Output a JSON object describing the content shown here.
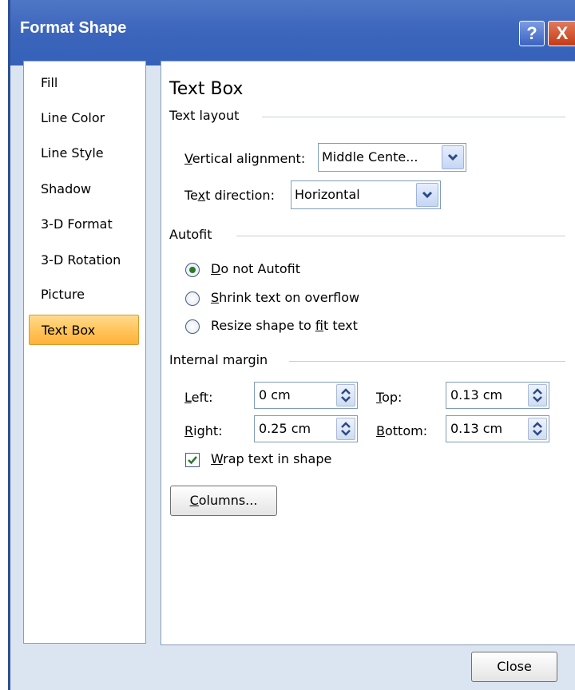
{
  "window": {
    "title": "Format Shape",
    "help_label": "?",
    "close_label": "X"
  },
  "nav": {
    "items": [
      {
        "label": "Fill"
      },
      {
        "label": "Line Color"
      },
      {
        "label": "Line Style"
      },
      {
        "label": "Shadow"
      },
      {
        "label": "3-D Format"
      },
      {
        "label": "3-D Rotation"
      },
      {
        "label": "Picture"
      },
      {
        "label": "Text Box",
        "selected": true
      }
    ]
  },
  "panel": {
    "heading": "Text Box",
    "text_layout": {
      "section_label": "Text layout",
      "vertical_alignment": {
        "label_key": "V",
        "label_rest": "ertical alignment:",
        "value": "Middle Cente..."
      },
      "text_direction": {
        "label_pre": "Te",
        "label_key": "x",
        "label_rest": "t direction:",
        "value": "Horizontal"
      }
    },
    "autofit": {
      "section_label": "Autofit",
      "options": [
        {
          "key": "D",
          "rest": "o not Autofit",
          "pre": "",
          "checked": true
        },
        {
          "key": "S",
          "rest": "hrink text on overflow",
          "pre": "",
          "checked": false
        },
        {
          "pre": "Resize shape to ",
          "key": "f",
          "rest": "it text",
          "checked": false
        }
      ]
    },
    "internal_margin": {
      "section_label": "Internal margin",
      "left": {
        "key": "L",
        "rest": "eft:",
        "value": "0 cm"
      },
      "right": {
        "key": "R",
        "rest": "ight:",
        "value": "0.25 cm"
      },
      "top": {
        "key": "T",
        "rest": "op:",
        "value": "0.13 cm"
      },
      "bottom": {
        "key": "B",
        "rest": "ottom:",
        "value": "0.13 cm"
      },
      "wrap": {
        "key": "W",
        "rest": "rap text in shape",
        "checked": true
      }
    },
    "columns_button": {
      "key": "C",
      "rest": "olumns..."
    }
  },
  "footer": {
    "close_label": "Close"
  },
  "colors": {
    "titlebar": "#3461b8",
    "dialog_bg": "#dbe5f1",
    "selected_nav": "#ffc55c"
  },
  "icons": [
    "help-icon",
    "close-icon",
    "chevron-down-icon",
    "spinner-arrows-icon",
    "checkmark-icon"
  ]
}
